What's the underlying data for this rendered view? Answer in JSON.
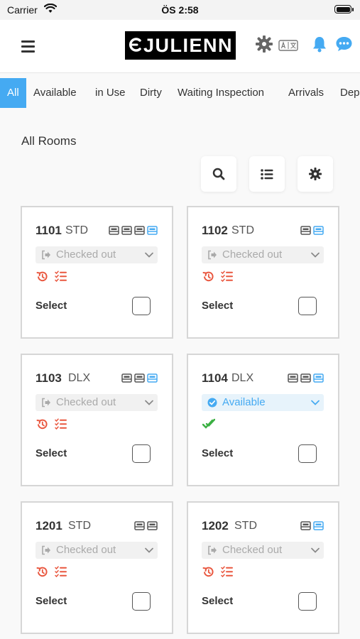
{
  "status_bar": {
    "carrier": "Carrier",
    "time": "ÖS 2:58"
  },
  "app_bar": {
    "logo_text": "JULIENN"
  },
  "tabs": [
    {
      "label": "All",
      "active": true
    },
    {
      "label": "Available"
    },
    {
      "label": "in Use"
    },
    {
      "label": "Dirty"
    },
    {
      "label": "Waiting Inspection"
    },
    {
      "label": "Arrivals"
    },
    {
      "label": "Dep"
    }
  ],
  "section_title": "All Rooms",
  "colors": {
    "accent": "#45aaf2",
    "warning": "#e9573f",
    "success": "#3cb043",
    "muted": "#aaaaaa"
  },
  "rooms": [
    {
      "number": "1101",
      "type": "STD",
      "beds": [
        "gray",
        "gray",
        "gray",
        "blue"
      ],
      "status": "Checked out",
      "status_kind": "checked-out",
      "select_label": "Select"
    },
    {
      "number": "1102",
      "type": "STD",
      "beds": [
        "gray",
        "blue"
      ],
      "status": "Checked out",
      "status_kind": "checked-out",
      "select_label": "Select"
    },
    {
      "number": "1103",
      "type": "DLX",
      "beds": [
        "gray",
        "gray",
        "blue"
      ],
      "status": "Checked out",
      "status_kind": "checked-out",
      "select_label": "Select"
    },
    {
      "number": "1104",
      "type": "DLX",
      "beds": [
        "gray",
        "gray",
        "blue"
      ],
      "status": "Available",
      "status_kind": "available",
      "select_label": "Select"
    },
    {
      "number": "1201",
      "type": "STD",
      "beds": [
        "gray",
        "gray"
      ],
      "status": "Checked out",
      "status_kind": "checked-out",
      "select_label": "Select"
    },
    {
      "number": "1202",
      "type": "STD",
      "beds": [
        "gray",
        "blue"
      ],
      "status": "Checked out",
      "status_kind": "checked-out",
      "select_label": "Select"
    }
  ]
}
